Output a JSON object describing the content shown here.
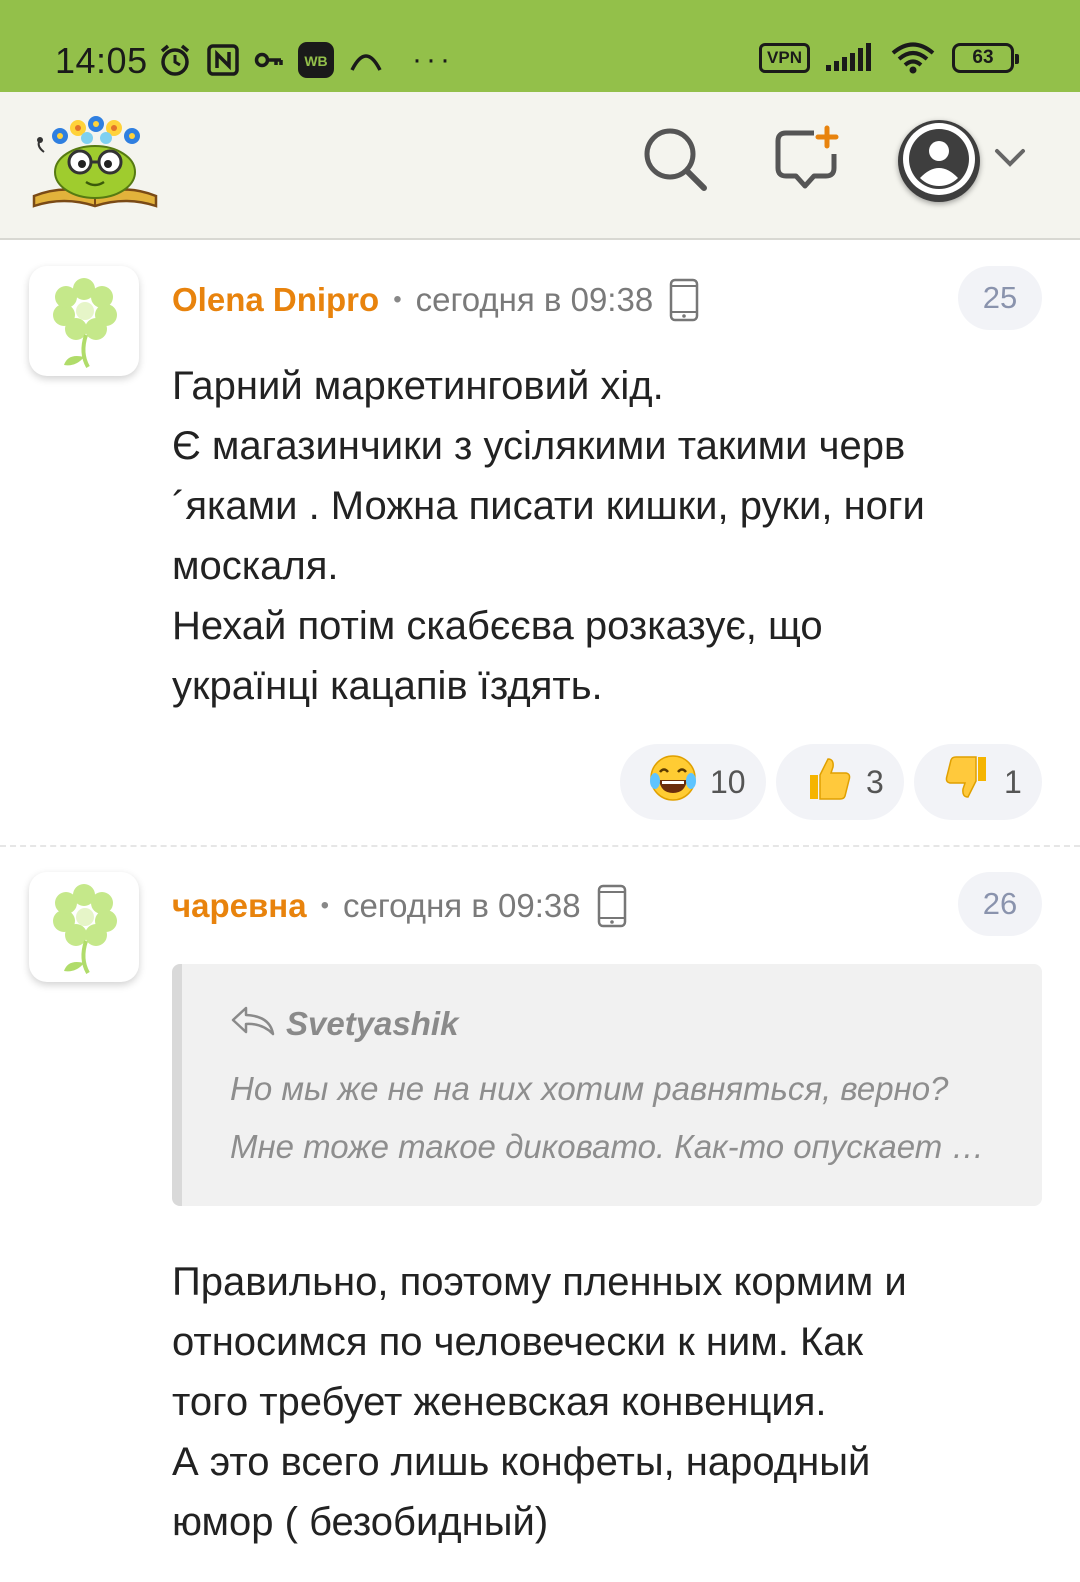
{
  "status_bar": {
    "time": "14:05",
    "left_icons": [
      "alarm-icon",
      "nfc-icon",
      "key-icon",
      "wb-icon",
      "arc-icon"
    ],
    "overflow": "···",
    "vpn": "VPN",
    "battery": "63",
    "bg_color": "#93c04a"
  },
  "header": {
    "logo": "book-mascot-logo",
    "actions": [
      "search-icon",
      "new-topic-icon",
      "user-avatar-icon",
      "chevron-down-icon"
    ]
  },
  "comments": [
    {
      "author": "Olena Dnipro",
      "separator": "•",
      "time": "сегодня в 09:38",
      "number": "25",
      "lines": [
        "Гарний маркетинговий хід.",
        "Є магазинчики з усілякими такими черв",
        "´яками . Можна писати кишки, руки, ноги",
        "москаля.",
        "Нехай потім скабєєва розказує, що",
        "українці кацапів їздять."
      ],
      "reactions": [
        {
          "icon": "laughing-emoji-icon",
          "count": "10"
        },
        {
          "icon": "thumbs-up-icon",
          "count": "3"
        },
        {
          "icon": "thumbs-down-icon",
          "count": "1"
        }
      ]
    },
    {
      "author": "чаревна",
      "separator": "•",
      "time": "сегодня в 09:38",
      "number": "26",
      "quote": {
        "author": "Svetyashik",
        "lines": [
          "Но мы же не на них хотим равняться, верно?",
          "Мне тоже такое диковато. Как-то опускает …"
        ]
      },
      "lines": [
        "Правильно, поэтому пленных кормим и",
        "относимся по человечески к ним. Как",
        "того требует женевская конвенция.",
        "А это всего лишь конфеты, народный",
        "юмор ( безобидный)"
      ]
    }
  ],
  "colors": {
    "author": "#e8830d",
    "header_bg": "#f4f4ee",
    "badge_bg": "#f2f3f7"
  }
}
